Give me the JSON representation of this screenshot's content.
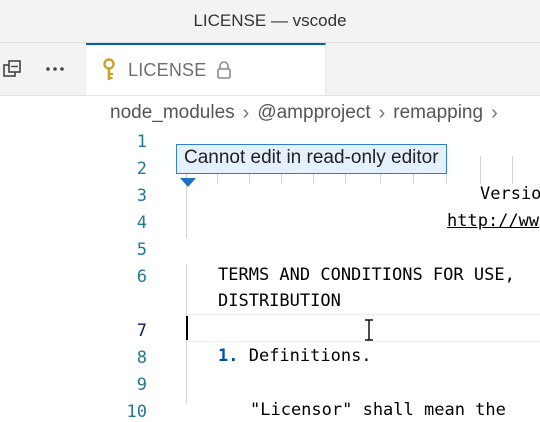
{
  "window": {
    "title": "LICENSE — vscode"
  },
  "tab": {
    "label": "LICENSE"
  },
  "breadcrumb": [
    "node_modules",
    "@ampproject",
    "remapping"
  ],
  "editor": {
    "line_numbers": [
      "1",
      "2",
      "3",
      "4",
      "5",
      "6",
      "7",
      "8",
      "9",
      "10"
    ],
    "lines": {
      "l3": "Versio",
      "l4": "http://ww",
      "l6": "TERMS AND CONDITIONS FOR USE,",
      "l6b": "DISTRIBUTION",
      "l8_num": "1.",
      "l8_text": " Definitions.",
      "l10": "\"Licensor\" shall mean the"
    }
  },
  "tooltip": {
    "text": "Cannot edit in read-only editor"
  },
  "colors": {
    "accent": "#005fb8",
    "line_number": "#237893",
    "tooltip_bg": "#e4f0fb"
  },
  "icons": [
    "split-editor-icon",
    "more-actions-icon",
    "key-icon",
    "lock-icon",
    "chevron-right-icon",
    "text-cursor-icon"
  ]
}
